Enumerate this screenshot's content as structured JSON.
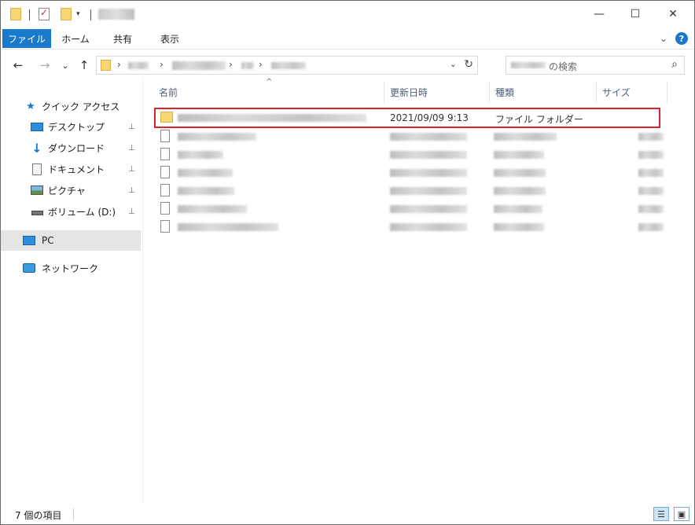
{
  "quick_access_toolbar": {
    "dropdown_glyph": "▾"
  },
  "window_controls": {
    "minimize": "—",
    "maximize": "☐",
    "close": "✕"
  },
  "ribbon": {
    "tabs": [
      "ファイル",
      "ホーム",
      "共有",
      "表示"
    ],
    "collapse_glyph": "⌄",
    "help_glyph": "?"
  },
  "navigation": {
    "back": "←",
    "forward": "→",
    "recent": "⌄",
    "up": "↑",
    "breadcrumb_separator": "›",
    "dropdown": "⌄",
    "refresh": "↻"
  },
  "search": {
    "placeholder": "の検索",
    "icon": "search-icon"
  },
  "nav_pane": {
    "items": [
      {
        "label": "クイック アクセス",
        "icon": "star-icon",
        "pinned": false
      },
      {
        "label": "デスクトップ",
        "icon": "desktop-icon",
        "pinned": true
      },
      {
        "label": "ダウンロード",
        "icon": "download-icon",
        "pinned": true
      },
      {
        "label": "ドキュメント",
        "icon": "document-icon",
        "pinned": true
      },
      {
        "label": "ピクチャ",
        "icon": "picture-icon",
        "pinned": true
      },
      {
        "label": "ボリューム (D:)",
        "icon": "drive-icon",
        "pinned": true
      },
      {
        "label": "PC",
        "icon": "pc-icon",
        "pinned": false,
        "selected": true
      },
      {
        "label": "ネットワーク",
        "icon": "network-icon",
        "pinned": false
      }
    ],
    "pin_glyph": "📌"
  },
  "file_list": {
    "columns": [
      "名前",
      "更新日時",
      "種類",
      "サイズ"
    ],
    "sort_glyph": "^",
    "rows": [
      {
        "name": "",
        "modified": "2021/09/09 9:13",
        "type": "ファイル フォルダー",
        "size": "",
        "kind": "folder",
        "highlighted": true
      },
      {
        "name": "",
        "modified": "",
        "type": "",
        "size": "",
        "kind": "file"
      },
      {
        "name": "",
        "modified": "",
        "type": "",
        "size": "",
        "kind": "file"
      },
      {
        "name": "",
        "modified": "",
        "type": "",
        "size": "",
        "kind": "file"
      },
      {
        "name": "",
        "modified": "",
        "type": "",
        "size": "",
        "kind": "file"
      },
      {
        "name": "",
        "modified": "",
        "type": "",
        "size": "",
        "kind": "file"
      },
      {
        "name": "",
        "modified": "",
        "type": "",
        "size": "",
        "kind": "file"
      }
    ]
  },
  "status_bar": {
    "item_count": "7 個の項目"
  },
  "colors": {
    "file_tab": "#1979ca",
    "highlight_border": "#d3262e",
    "folder": "#f7d774",
    "selected_bg": "#e5e5e5"
  }
}
